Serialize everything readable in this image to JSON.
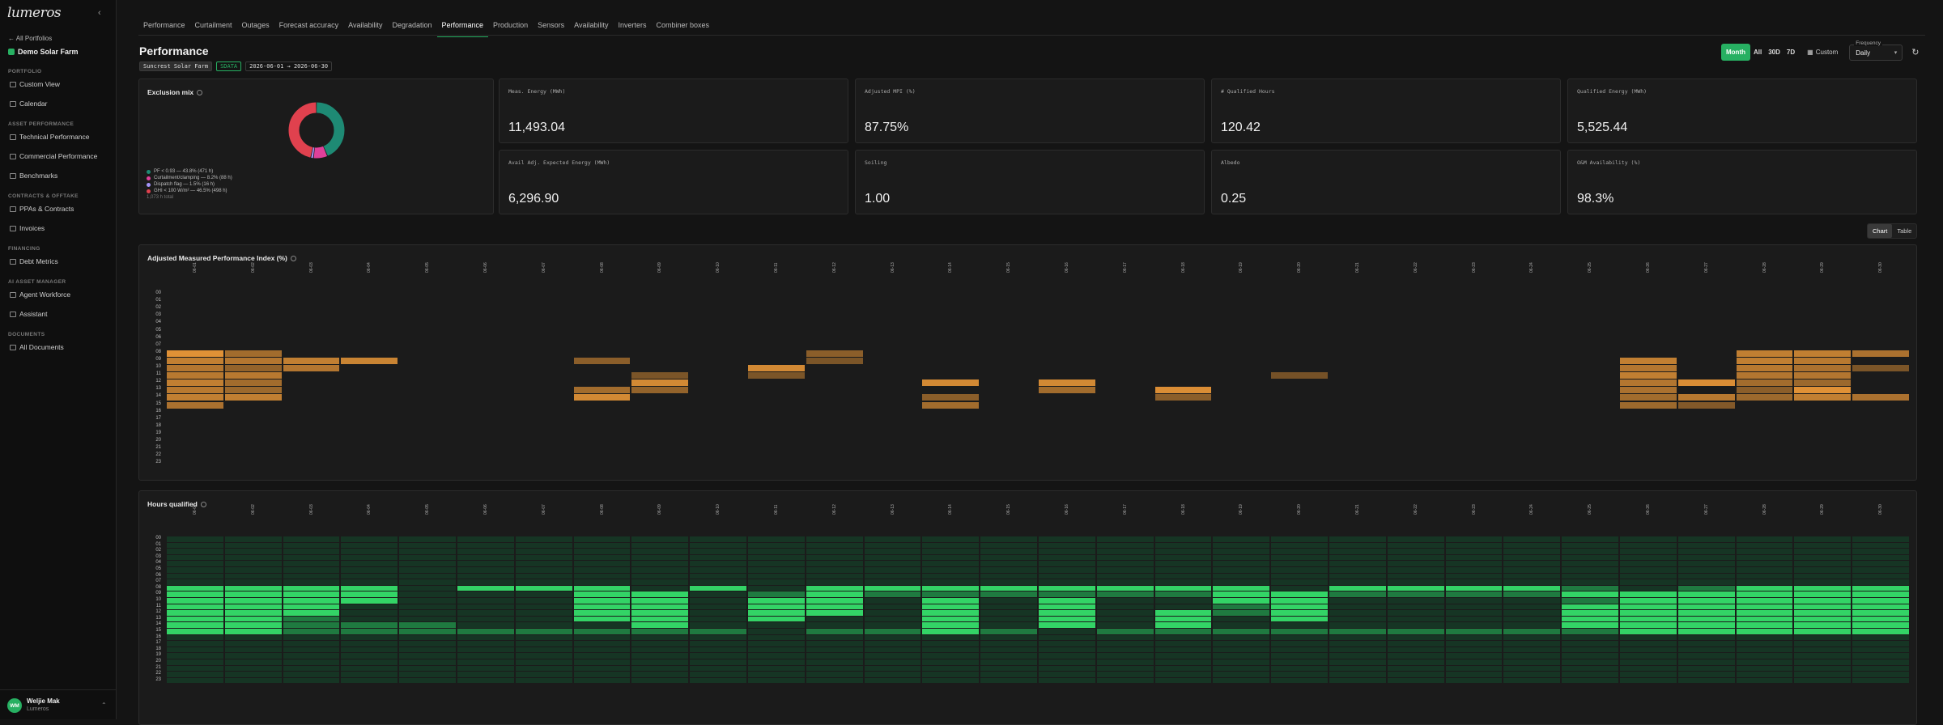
{
  "app": {
    "logo": "lumeros",
    "collapse_icon": "chevron-left-icon"
  },
  "sidebar": {
    "back_label": "All Portfolios",
    "portfolio_name": "Demo Solar Farm",
    "sections": [
      {
        "label": "Portfolio",
        "items": [
          {
            "label": "Custom View",
            "icon": "grid-icon"
          },
          {
            "label": "Calendar",
            "icon": "calendar-icon"
          }
        ]
      },
      {
        "label": "Asset Performance",
        "items": [
          {
            "label": "Technical Performance",
            "icon": "trend-icon"
          },
          {
            "label": "Commercial Performance",
            "icon": "trend-icon"
          },
          {
            "label": "Benchmarks",
            "icon": "trend-icon"
          }
        ]
      },
      {
        "label": "Contracts & Offtake",
        "items": [
          {
            "label": "PPAs & Contracts",
            "icon": "document-icon"
          },
          {
            "label": "Invoices",
            "icon": "invoice-icon"
          }
        ]
      },
      {
        "label": "Financing",
        "items": [
          {
            "label": "Debt Metrics",
            "icon": "bank-icon"
          }
        ]
      },
      {
        "label": "AI Asset Manager",
        "items": [
          {
            "label": "Agent Workforce",
            "icon": "sparkle-icon"
          },
          {
            "label": "Assistant",
            "icon": "sparkle-icon"
          }
        ]
      },
      {
        "label": "Documents",
        "items": [
          {
            "label": "All Documents",
            "icon": "folder-icon"
          }
        ]
      }
    ],
    "user": {
      "initials": "WM",
      "name": "Weljie Mak",
      "org": "Lumeros"
    }
  },
  "tabs": [
    {
      "label": "Performance",
      "active": false
    },
    {
      "label": "Curtailment",
      "active": false
    },
    {
      "label": "Outages",
      "active": false
    },
    {
      "label": "Forecast accuracy",
      "active": false
    },
    {
      "label": "Availability",
      "active": false
    },
    {
      "label": "Degradation",
      "active": false
    },
    {
      "label": "Performance",
      "active": true
    },
    {
      "label": "Production",
      "active": false
    },
    {
      "label": "Sensors",
      "active": false
    },
    {
      "label": "Availability",
      "active": false
    },
    {
      "label": "Inverters",
      "active": false
    },
    {
      "label": "Combiner boxes",
      "active": false
    }
  ],
  "page": {
    "title": "Performance",
    "farm_chip": "Suncrest Solar Farm",
    "status_chip": "SDATA",
    "date_range": "2026-06-01 → 2026-06-30"
  },
  "controls": {
    "periods": [
      {
        "label": "Month",
        "active": true
      },
      {
        "label": "All",
        "active": false
      },
      {
        "label": "30D",
        "active": false
      },
      {
        "label": "7D",
        "active": false
      }
    ],
    "custom_label": "Custom",
    "frequency_label": "Frequency",
    "frequency_value": "Daily"
  },
  "exclusion_mix": {
    "title": "Exclusion mix",
    "legend": [
      {
        "label": "PF < 0.93 — 43.8% (471 h)",
        "color": "#1e8a74",
        "value": 43.8
      },
      {
        "label": "Curtailment/clamping — 8.2% (88 h)",
        "color": "#e0409a",
        "value": 8.2
      },
      {
        "label": "Dispatch flag — 1.5% (16 h)",
        "color": "#a594f9",
        "value": 1.5
      },
      {
        "label": "GHI < 100 W/m² — 46.5% (498 h)",
        "color": "#e0414e",
        "value": 46.5
      }
    ],
    "total": "1,073 h total"
  },
  "kpis": [
    {
      "label": "Meas. Energy (MWh)",
      "value": "11,493.04"
    },
    {
      "label": "Adjusted MPI (%)",
      "value": "87.75%"
    },
    {
      "label": "# Qualified Hours",
      "value": "120.42"
    },
    {
      "label": "Qualified Energy (MWh)",
      "value": "5,525.44"
    },
    {
      "label": "Avail Adj. Expected Energy (MWh)",
      "value": "6,296.90"
    },
    {
      "label": "Soiling",
      "value": "1.00"
    },
    {
      "label": "Albedo",
      "value": "0.25"
    },
    {
      "label": "O&M Availability (%)",
      "value": "98.3%"
    }
  ],
  "view_toggle": [
    {
      "label": "Chart",
      "active": true
    },
    {
      "label": "Table",
      "active": false
    }
  ],
  "heatmap1": {
    "title": "Adjusted Measured Performance Index (%)",
    "hours": [
      "00",
      "01",
      "02",
      "03",
      "04",
      "05",
      "06",
      "07",
      "08",
      "09",
      "10",
      "11",
      "12",
      "13",
      "14",
      "15",
      "16",
      "17",
      "18",
      "19",
      "20",
      "21",
      "22",
      "23"
    ],
    "days": [
      "06-01",
      "06-02",
      "06-03",
      "06-04",
      "06-05",
      "06-06",
      "06-07",
      "06-08",
      "06-09",
      "06-10",
      "06-11",
      "06-12",
      "06-13",
      "06-14",
      "06-15",
      "06-16",
      "06-17",
      "06-18",
      "06-19",
      "06-20",
      "06-21",
      "06-22",
      "06-23",
      "06-24",
      "06-25",
      "06-26",
      "06-27",
      "06-28",
      "06-29",
      "06-30"
    ],
    "cells": [
      [
        0,
        8,
        0.95
      ],
      [
        0,
        9,
        0.75
      ],
      [
        0,
        10,
        0.65
      ],
      [
        0,
        11,
        0.7
      ],
      [
        0,
        12,
        0.75
      ],
      [
        0,
        13,
        0.7
      ],
      [
        0,
        14,
        0.75
      ],
      [
        0,
        15,
        0.6
      ],
      [
        1,
        8,
        0.55
      ],
      [
        1,
        9,
        0.65
      ],
      [
        1,
        10,
        0.45
      ],
      [
        1,
        11,
        0.7
      ],
      [
        1,
        12,
        0.55
      ],
      [
        1,
        13,
        0.5
      ],
      [
        1,
        14,
        0.75
      ],
      [
        2,
        9,
        0.75
      ],
      [
        2,
        10,
        0.65
      ],
      [
        3,
        9,
        0.8
      ],
      [
        7,
        9,
        0.4
      ],
      [
        7,
        13,
        0.55
      ],
      [
        7,
        14,
        0.85
      ],
      [
        8,
        11,
        0.3
      ],
      [
        8,
        12,
        0.85
      ],
      [
        8,
        13,
        0.45
      ],
      [
        10,
        10,
        0.85
      ],
      [
        10,
        11,
        0.3
      ],
      [
        11,
        8,
        0.4
      ],
      [
        11,
        9,
        0.3
      ],
      [
        13,
        12,
        0.85
      ],
      [
        13,
        14,
        0.4
      ],
      [
        13,
        15,
        0.55
      ],
      [
        15,
        12,
        0.85
      ],
      [
        15,
        13,
        0.55
      ],
      [
        17,
        13,
        0.9
      ],
      [
        17,
        14,
        0.4
      ],
      [
        19,
        11,
        0.25
      ],
      [
        25,
        9,
        0.75
      ],
      [
        25,
        10,
        0.65
      ],
      [
        25,
        11,
        0.75
      ],
      [
        25,
        12,
        0.65
      ],
      [
        25,
        13,
        0.6
      ],
      [
        25,
        14,
        0.55
      ],
      [
        25,
        15,
        0.5
      ],
      [
        26,
        12,
        0.9
      ],
      [
        26,
        14,
        0.7
      ],
      [
        26,
        15,
        0.35
      ],
      [
        27,
        8,
        0.75
      ],
      [
        27,
        9,
        0.75
      ],
      [
        27,
        10,
        0.7
      ],
      [
        27,
        11,
        0.65
      ],
      [
        27,
        12,
        0.55
      ],
      [
        27,
        13,
        0.4
      ],
      [
        27,
        14,
        0.5
      ],
      [
        28,
        8,
        0.75
      ],
      [
        28,
        9,
        0.7
      ],
      [
        28,
        10,
        0.6
      ],
      [
        28,
        11,
        0.65
      ],
      [
        28,
        12,
        0.5
      ],
      [
        28,
        13,
        0.95
      ],
      [
        28,
        14,
        0.75
      ],
      [
        29,
        8,
        0.6
      ],
      [
        29,
        10,
        0.3
      ],
      [
        29,
        14,
        0.6
      ]
    ]
  },
  "heatmap2": {
    "title": "Hours qualified",
    "hours": [
      "00",
      "01",
      "02",
      "03",
      "04",
      "05",
      "06",
      "07",
      "08",
      "09",
      "10",
      "11",
      "12",
      "13",
      "14",
      "15",
      "16",
      "17",
      "18",
      "19",
      "20",
      "21",
      "22",
      "23"
    ],
    "bright": [
      [
        0,
        8
      ],
      [
        0,
        9
      ],
      [
        0,
        10
      ],
      [
        0,
        11
      ],
      [
        0,
        12
      ],
      [
        0,
        13
      ],
      [
        0,
        14
      ],
      [
        0,
        15
      ],
      [
        1,
        8
      ],
      [
        1,
        9
      ],
      [
        1,
        10
      ],
      [
        1,
        11
      ],
      [
        1,
        12
      ],
      [
        1,
        13
      ],
      [
        1,
        14
      ],
      [
        1,
        15
      ],
      [
        2,
        8
      ],
      [
        2,
        9
      ],
      [
        2,
        10
      ],
      [
        2,
        11
      ],
      [
        2,
        12
      ],
      [
        3,
        8
      ],
      [
        3,
        9
      ],
      [
        3,
        10
      ],
      [
        5,
        8
      ],
      [
        6,
        8
      ],
      [
        7,
        8
      ],
      [
        7,
        9
      ],
      [
        7,
        10
      ],
      [
        7,
        11
      ],
      [
        7,
        12
      ],
      [
        7,
        13
      ],
      [
        8,
        9
      ],
      [
        8,
        10
      ],
      [
        8,
        11
      ],
      [
        8,
        12
      ],
      [
        8,
        13
      ],
      [
        8,
        14
      ],
      [
        9,
        8
      ],
      [
        10,
        10
      ],
      [
        10,
        11
      ],
      [
        10,
        12
      ],
      [
        10,
        13
      ],
      [
        11,
        8
      ],
      [
        11,
        9
      ],
      [
        11,
        10
      ],
      [
        11,
        11
      ],
      [
        11,
        12
      ],
      [
        12,
        8
      ],
      [
        13,
        8
      ],
      [
        13,
        10
      ],
      [
        13,
        11
      ],
      [
        13,
        12
      ],
      [
        13,
        13
      ],
      [
        13,
        14
      ],
      [
        13,
        15
      ],
      [
        14,
        8
      ],
      [
        15,
        8
      ],
      [
        15,
        10
      ],
      [
        15,
        11
      ],
      [
        15,
        12
      ],
      [
        15,
        13
      ],
      [
        15,
        14
      ],
      [
        16,
        8
      ],
      [
        17,
        8
      ],
      [
        17,
        12
      ],
      [
        17,
        13
      ],
      [
        17,
        14
      ],
      [
        18,
        8
      ],
      [
        18,
        9
      ],
      [
        18,
        10
      ],
      [
        19,
        9
      ],
      [
        19,
        10
      ],
      [
        19,
        11
      ],
      [
        19,
        12
      ],
      [
        19,
        13
      ],
      [
        20,
        8
      ],
      [
        21,
        8
      ],
      [
        22,
        8
      ],
      [
        23,
        8
      ],
      [
        24,
        9
      ],
      [
        24,
        11
      ],
      [
        24,
        12
      ],
      [
        24,
        13
      ],
      [
        24,
        14
      ],
      [
        25,
        9
      ],
      [
        25,
        10
      ],
      [
        25,
        11
      ],
      [
        25,
        12
      ],
      [
        25,
        13
      ],
      [
        25,
        14
      ],
      [
        25,
        15
      ],
      [
        26,
        9
      ],
      [
        26,
        10
      ],
      [
        26,
        11
      ],
      [
        26,
        12
      ],
      [
        26,
        13
      ],
      [
        26,
        14
      ],
      [
        26,
        15
      ],
      [
        27,
        8
      ],
      [
        27,
        9
      ],
      [
        27,
        10
      ],
      [
        27,
        11
      ],
      [
        27,
        12
      ],
      [
        27,
        13
      ],
      [
        27,
        14
      ],
      [
        27,
        15
      ],
      [
        28,
        8
      ],
      [
        28,
        9
      ],
      [
        28,
        10
      ],
      [
        28,
        11
      ],
      [
        28,
        12
      ],
      [
        28,
        13
      ],
      [
        28,
        14
      ],
      [
        28,
        15
      ],
      [
        29,
        8
      ],
      [
        29,
        9
      ],
      [
        29,
        10
      ],
      [
        29,
        11
      ],
      [
        29,
        12
      ],
      [
        29,
        13
      ],
      [
        29,
        14
      ],
      [
        29,
        15
      ]
    ],
    "mid": [
      [
        2,
        13
      ],
      [
        2,
        14
      ],
      [
        2,
        15
      ],
      [
        3,
        14
      ],
      [
        3,
        15
      ],
      [
        4,
        14
      ],
      [
        4,
        15
      ],
      [
        5,
        15
      ],
      [
        6,
        15
      ],
      [
        7,
        15
      ],
      [
        8,
        15
      ],
      [
        9,
        15
      ],
      [
        11,
        15
      ],
      [
        12,
        15
      ],
      [
        13,
        9
      ],
      [
        14,
        15
      ],
      [
        15,
        9
      ],
      [
        16,
        15
      ],
      [
        17,
        15
      ],
      [
        18,
        11
      ],
      [
        18,
        15
      ],
      [
        19,
        15
      ],
      [
        20,
        15
      ],
      [
        21,
        15
      ],
      [
        22,
        15
      ],
      [
        23,
        15
      ],
      [
        24,
        8
      ],
      [
        24,
        10
      ],
      [
        24,
        15
      ],
      [
        26,
        8
      ],
      [
        10,
        9
      ],
      [
        17,
        9
      ],
      [
        18,
        12
      ],
      [
        12,
        9
      ],
      [
        14,
        9
      ],
      [
        16,
        9
      ],
      [
        20,
        9
      ],
      [
        21,
        9
      ],
      [
        22,
        9
      ],
      [
        23,
        9
      ]
    ]
  }
}
